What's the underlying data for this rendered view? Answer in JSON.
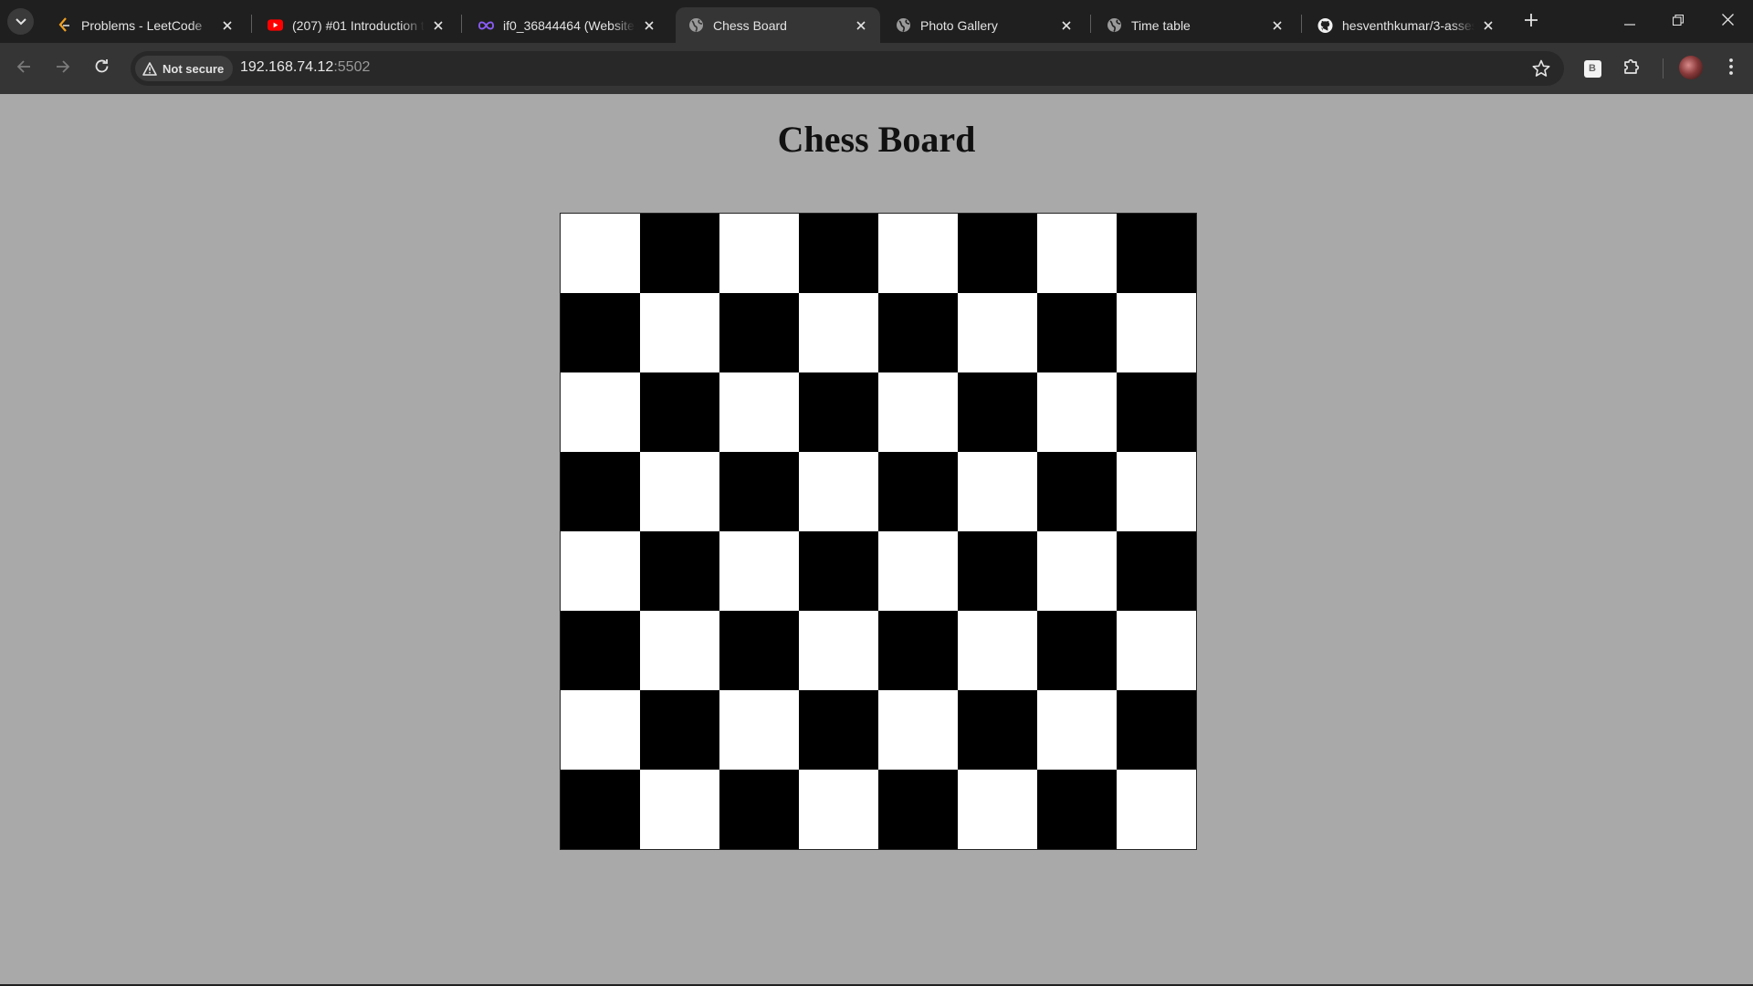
{
  "browser": {
    "tabs": [
      {
        "title": "Problems - LeetCode",
        "favicon": "leetcode-icon",
        "active": false
      },
      {
        "title": "(207) #01 Introduction to",
        "favicon": "youtube-icon",
        "active": false
      },
      {
        "title": "if0_36844464 (Website fo",
        "favicon": "infinityfree-icon",
        "active": false
      },
      {
        "title": "Chess Board",
        "favicon": "globe-icon",
        "active": true
      },
      {
        "title": "Photo Gallery",
        "favicon": "globe-icon",
        "active": false
      },
      {
        "title": "Time table",
        "favicon": "globe-icon",
        "active": false
      },
      {
        "title": "hesventhkumar/3-assess",
        "favicon": "github-icon",
        "active": false
      }
    ],
    "address": {
      "security_label": "Not secure",
      "host": "192.168.74.12",
      "port": ":5502"
    },
    "extension_label": "B",
    "colors": {
      "tabbar": "#1f1f1f",
      "toolbar": "#353535",
      "page_bg": "#a9a9a9"
    }
  },
  "page": {
    "title": "Chess Board",
    "board": {
      "rows": 8,
      "cols": 8,
      "top_left_color": "white",
      "light_color": "#ffffff",
      "dark_color": "#000000"
    }
  }
}
